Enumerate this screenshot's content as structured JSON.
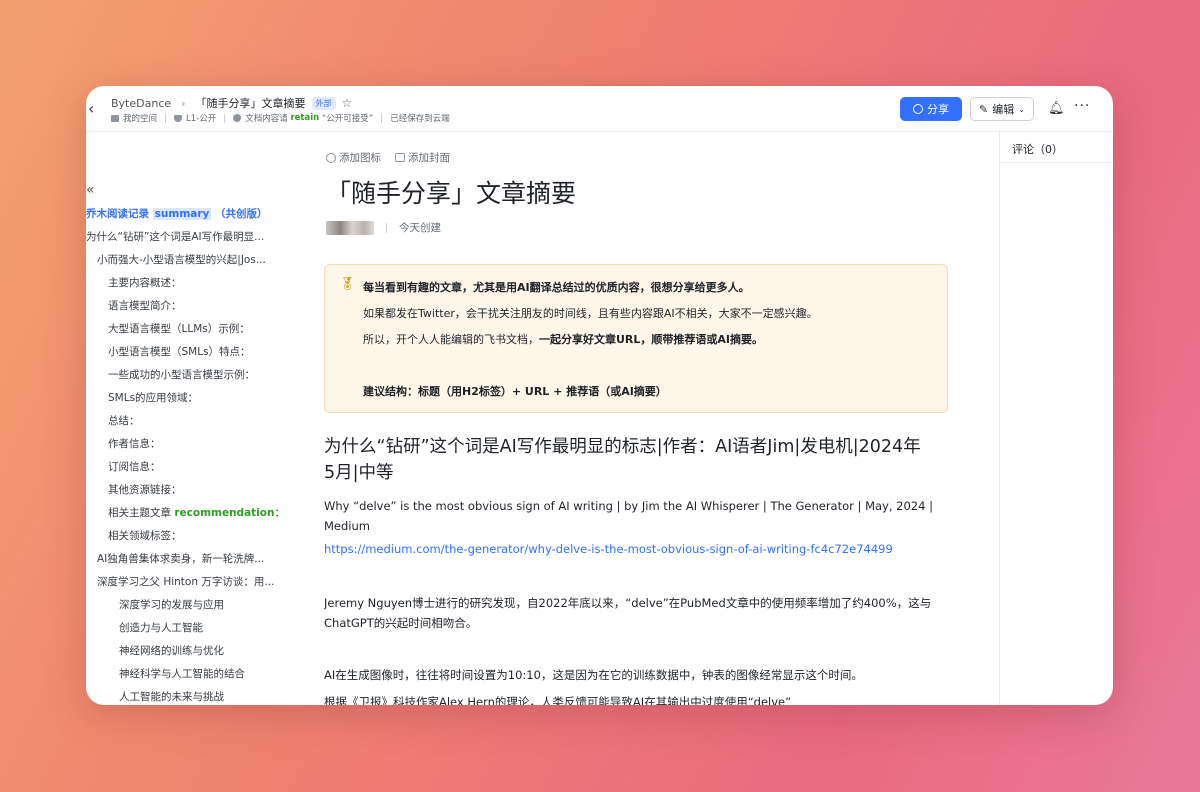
{
  "header": {
    "breadcrumb_root": "ByteDance",
    "breadcrumb_sep": "›",
    "doc_title": "「随手分享」文章摘要",
    "external_badge": "外部",
    "meta": {
      "space": "我的空间",
      "permission": "L1-公开",
      "content_prefix": "文档内容请",
      "content_retain": "retain",
      "content_suffix": "“公开可接受”",
      "save_status": "已经保存到云端"
    },
    "share_label": "分享",
    "edit_label": "编辑"
  },
  "comments": {
    "title": "评论（0）"
  },
  "sidebar": {
    "toc": [
      {
        "level": 0,
        "text": "乔木阅读记录 ",
        "highlight": "summary",
        "suffix": " （共创版）",
        "active": true
      },
      {
        "level": 0,
        "text": "为什么“钻研”这个词是AI写作最明显..."
      },
      {
        "level": 1,
        "text": "小而强大-小型语言模型的兴起|Jos..."
      },
      {
        "level": 2,
        "text": "主要内容概述："
      },
      {
        "level": 2,
        "text": "语言模型简介："
      },
      {
        "level": 2,
        "text": "大型语言模型（LLMs）示例："
      },
      {
        "level": 2,
        "text": "小型语言模型（SMLs）特点："
      },
      {
        "level": 2,
        "text": "一些成功的小型语言模型示例："
      },
      {
        "level": 2,
        "text": "SMLs的应用领域："
      },
      {
        "level": 2,
        "text": "总结："
      },
      {
        "level": 2,
        "text": "作者信息："
      },
      {
        "level": 2,
        "text": "订阅信息："
      },
      {
        "level": 2,
        "text": "其他资源链接："
      },
      {
        "level": 2,
        "text": "相关主题文章 ",
        "green": "recommendation",
        "suffix": "："
      },
      {
        "level": 2,
        "text": "相关领域标签："
      },
      {
        "level": 1,
        "text": "AI独角兽集体求卖身，新一轮洗牌..."
      },
      {
        "level": 1,
        "text": "深度学习之父 Hinton 万字访谈：用..."
      },
      {
        "level": 3,
        "text": "深度学习的发展与应用"
      },
      {
        "level": 3,
        "text": "创造力与人工智能"
      },
      {
        "level": 3,
        "text": "神经网络的训练与优化"
      },
      {
        "level": 3,
        "text": "神经科学与人工智能的结合"
      },
      {
        "level": 3,
        "text": "人工智能的未来与挑战"
      }
    ]
  },
  "doc": {
    "add_icon_label": "添加图标",
    "add_cover_label": "添加封面",
    "title": "「随手分享」文章摘要",
    "created": "今天创建",
    "callout": {
      "icon": "medal-icon",
      "line1": "每当看到有趣的文章，尤其是用AI翻译总结过的优质内容，很想分享给更多人。",
      "line2": "如果都发在Twitter，会干扰关注朋友的时间线，且有些内容跟AI不相关，大家不一定感兴趣。",
      "line3_plain": "所以，开个人人能编辑的飞书文档，",
      "line3_bold": "一起分享好文章URL，顺带推荐语或AI摘要。",
      "line4": "建议结构：标题（用H2标签）+ URL + 推荐语（或AI摘要）"
    },
    "h2": "为什么“钻研”这个词是AI写作最明显的标志|作者：AI语者Jim|发电机|2024年5月|中等",
    "p1": "Why “delve” is the most obvious sign of AI writing | by Jim the AI Whisperer | The Generator | May, 2024 | Medium",
    "link": "https://medium.com/the-generator/why-delve-is-the-most-obvious-sign-of-ai-writing-fc4c72e74499",
    "p2": "Jeremy Nguyen博士进行的研究发现，自2022年底以来，“delve”在PubMed文章中的使用频率增加了约400%，这与ChatGPT的兴起时间相吻合。",
    "p3": "AI在生成图像时，往往将时间设置为10:10，这是因为在它的训练数据中，钟表的图像经常显示这个时间。",
    "p4": "根据《卫报》科技作家Alex Hern的理论，人类反馈可能导致AI在其输出中过度使用“delve”"
  }
}
